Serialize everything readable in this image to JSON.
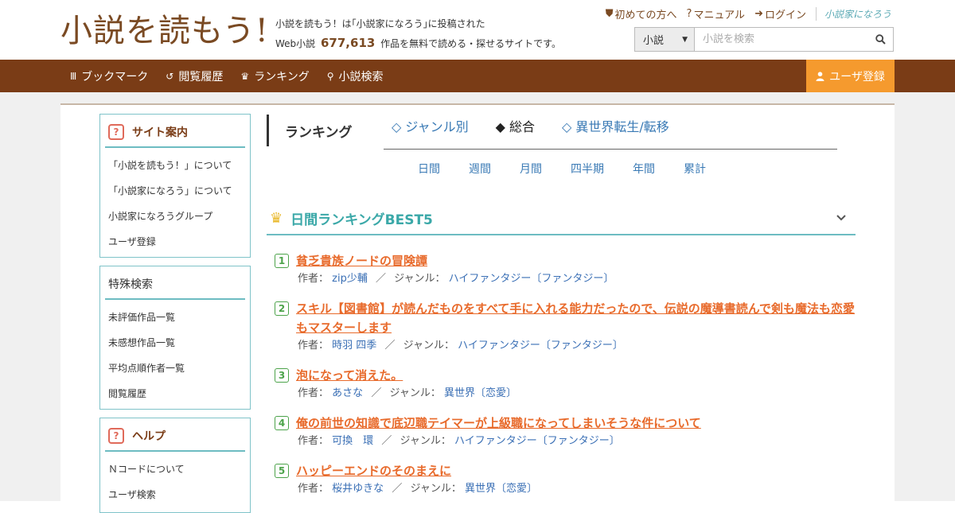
{
  "header": {
    "logo": "小説を読もう!",
    "tagline_line1": "小説を読もう！は｢小説家になろう｣に投稿された",
    "tagline_prefix": "Web小説",
    "tagline_count": "677,613",
    "tagline_suffix": "作品を無料で読める・探せるサイトです。",
    "links": [
      {
        "icon": "shield-icon",
        "glyph": "⛊",
        "label": "初めての方へ"
      },
      {
        "icon": "help-icon",
        "glyph": "?",
        "label": "マニュアル"
      },
      {
        "icon": "login-icon",
        "glyph": "➜",
        "label": "ログイン"
      }
    ],
    "brand": "小説家になろう",
    "search": {
      "category": "小説",
      "placeholder": "小説を検索"
    }
  },
  "nav": {
    "items": [
      {
        "name": "bookmark",
        "icon": "bookmark-icon",
        "glyph": "Ⅲ",
        "label": "ブックマーク"
      },
      {
        "name": "history",
        "icon": "history-icon",
        "glyph": "↺",
        "label": "閲覧履歴"
      },
      {
        "name": "ranking",
        "icon": "crown-icon",
        "glyph": "♛",
        "label": "ランキング"
      },
      {
        "name": "search",
        "icon": "search-icon",
        "glyph": "⚲",
        "label": "小説検索"
      }
    ],
    "register": "ユーザ登録"
  },
  "sidebar": {
    "site_info": {
      "title": "サイト案内",
      "items": [
        "「小説を読もう！」について",
        "「小説家になろう」について",
        "小説家になろうグループ",
        "ユーザ登録"
      ]
    },
    "special_search": {
      "title": "特殊検索",
      "items": [
        "未評価作品一覧",
        "未感想作品一覧",
        "平均点順作者一覧",
        "閲覧履歴"
      ]
    },
    "help": {
      "title": "ヘルプ",
      "items": [
        "Ｎコードについて",
        "ユーザ検索"
      ]
    }
  },
  "ranking": {
    "heading": "ランキング",
    "tabs": [
      {
        "label": "◇ ジャンル別",
        "active": false
      },
      {
        "label": "◆ 総合",
        "active": true
      },
      {
        "label": "◇ 異世界転生/転移",
        "active": false
      }
    ],
    "periods": [
      "日間",
      "週間",
      "月間",
      "四半期",
      "年間",
      "累計"
    ],
    "best_title": "日間ランキングBEST5",
    "author_label": "作者：",
    "genre_label": "ジャンル：",
    "separator": "／",
    "entries": [
      {
        "rank": "1",
        "title": "貧乏貴族ノードの冒険譚",
        "author": "zip少輔",
        "genre": "ハイファンタジー〔ファンタジー〕"
      },
      {
        "rank": "2",
        "title": "スキル【図書館】が読んだものをすべて手に入れる能力だったので、伝説の魔導書読んで剣も魔法も恋愛もマスターします",
        "author": "時羽 四季",
        "genre": "ハイファンタジー〔ファンタジー〕"
      },
      {
        "rank": "3",
        "title": "泡になって消えた。",
        "author": "あさな",
        "genre": "異世界〔恋愛〕"
      },
      {
        "rank": "4",
        "title": "俺の前世の知識で底辺職テイマーが上級職になってしまいそうな件について",
        "author": "可換　環",
        "genre": "ハイファンタジー〔ファンタジー〕"
      },
      {
        "rank": "5",
        "title": "ハッピーエンドのそのまえに",
        "author": "桜井ゆきな",
        "genre": "異世界〔恋愛〕"
      }
    ]
  }
}
